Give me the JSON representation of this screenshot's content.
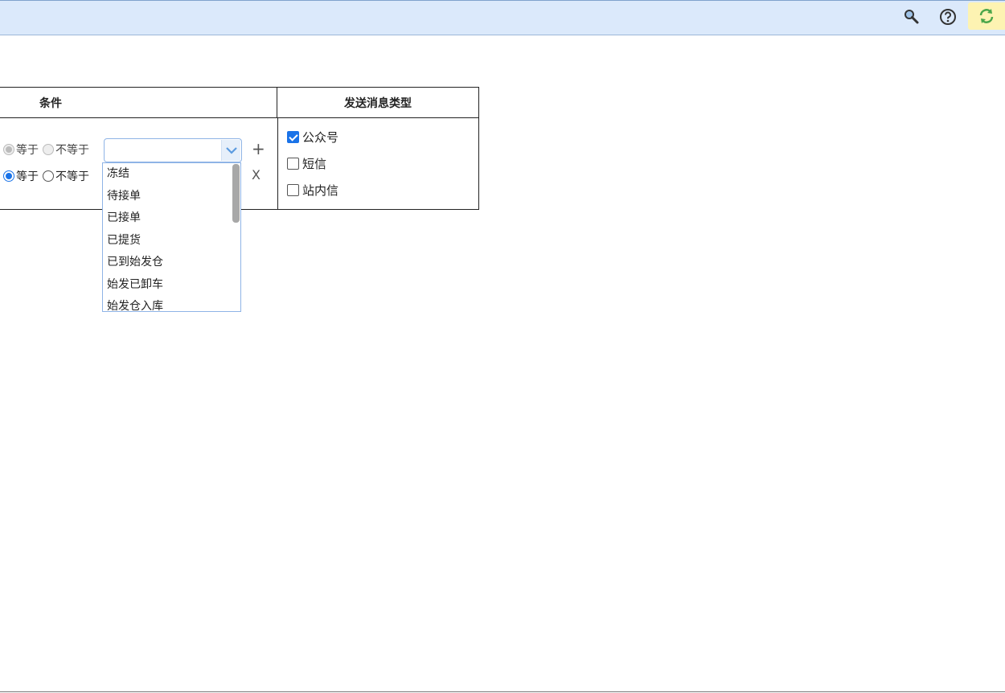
{
  "toolbar": {
    "icons": [
      "search-icon",
      "help-icon",
      "refresh-icon"
    ],
    "accent": "#dbe9fb"
  },
  "table": {
    "col_condition": "条件",
    "col_message_type": "发送消息类型"
  },
  "conditions": [
    {
      "equal_label": "等于",
      "not_equal_label": "不等于",
      "selected": "equal",
      "disabled": true,
      "action": "+"
    },
    {
      "equal_label": "等于",
      "not_equal_label": "不等于",
      "selected": "equal",
      "disabled": false,
      "action": "X"
    }
  ],
  "status_select": {
    "value": "",
    "options": [
      "冻结",
      "待接单",
      "已接单",
      "已提货",
      "已到始发仓",
      "始发已卸车",
      "始发仓入库"
    ]
  },
  "message_types": [
    {
      "label": "公众号",
      "checked": true
    },
    {
      "label": "短信",
      "checked": false
    },
    {
      "label": "站内信",
      "checked": false
    }
  ],
  "colors": {
    "primary": "#1a73e8",
    "highlight": "#fdf3b2"
  }
}
